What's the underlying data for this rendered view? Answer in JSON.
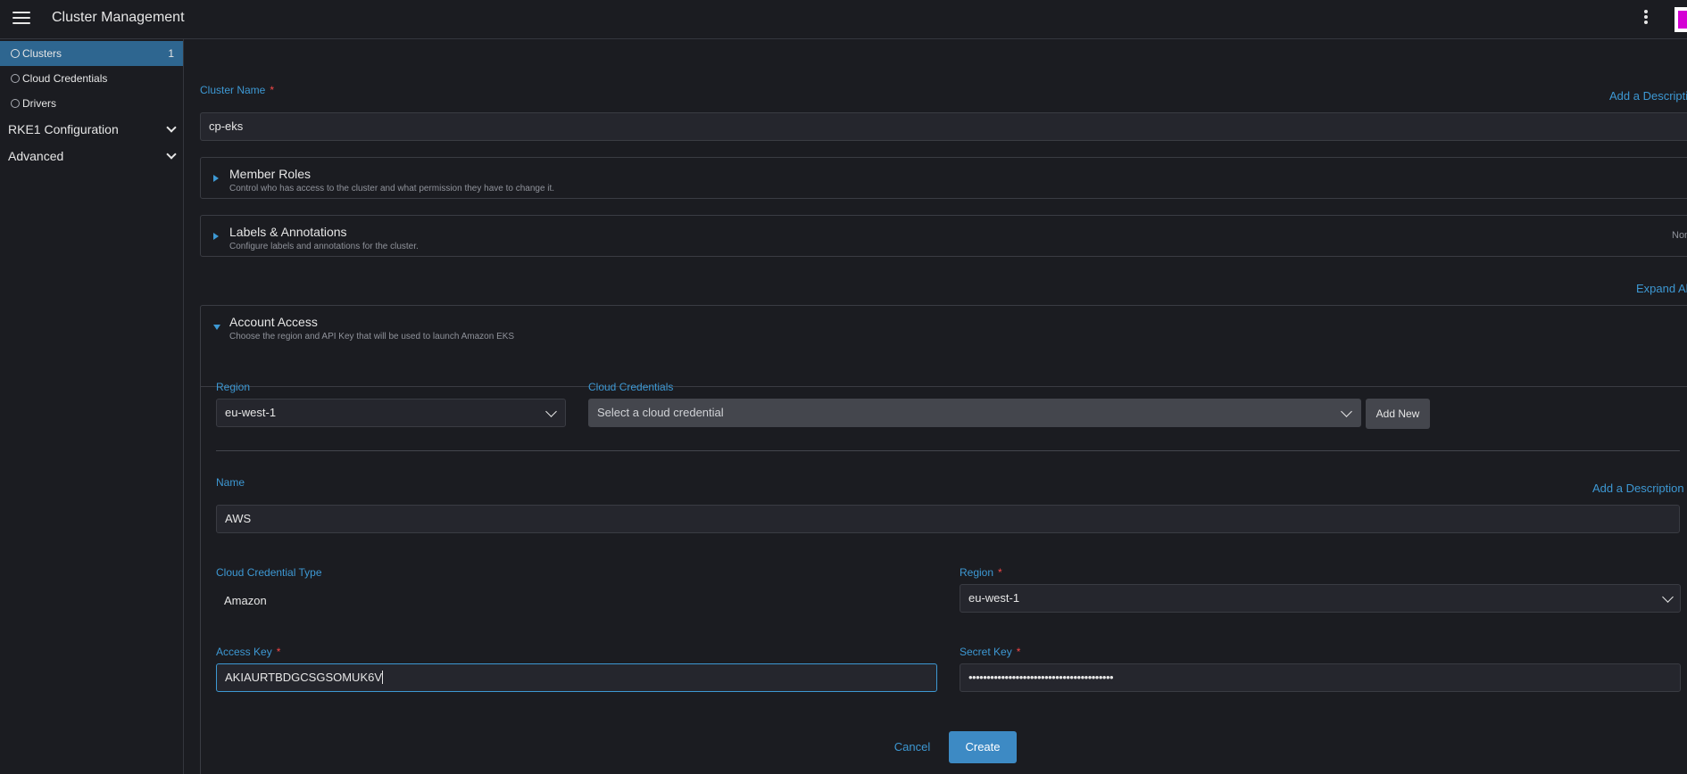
{
  "header": {
    "title": "Cluster Management"
  },
  "sidebar": {
    "items": [
      {
        "label": "Clusters",
        "count": "1"
      },
      {
        "label": "Cloud Credentials"
      },
      {
        "label": "Drivers"
      }
    ],
    "groups": [
      {
        "label": "RKE1 Configuration"
      },
      {
        "label": "Advanced"
      }
    ]
  },
  "form": {
    "cluster_name_label": "Cluster Name",
    "required_mark": "*",
    "add_description": "Add a Descripti",
    "cluster_name_value": "cp-eks",
    "expand_all": "Expand All"
  },
  "panels": {
    "member_roles": {
      "title": "Member Roles",
      "subtitle": "Control who has access to the cluster and what permission they have to change it."
    },
    "labels": {
      "title": "Labels & Annotations",
      "subtitle": "Configure labels and annotations for the cluster.",
      "badge": "None"
    },
    "account_access": {
      "title": "Account Access",
      "subtitle": "Choose the region and API Key that will be used to launch Amazon EKS"
    }
  },
  "account": {
    "region_label": "Region",
    "region_value": "eu-west-1",
    "cloud_credentials_label": "Cloud Credentials",
    "cloud_credentials_placeholder": "Select a cloud credential",
    "add_new": "Add New"
  },
  "credential": {
    "name_label": "Name",
    "add_description": "Add a Description",
    "name_value": "AWS",
    "type_label": "Cloud Credential Type",
    "type_value": "Amazon",
    "region_label": "Region",
    "region_value": "eu-west-1",
    "access_key_label": "Access Key",
    "access_key_value": "AKIAURTBDGCSGSOMUK6V",
    "secret_key_label": "Secret Key",
    "secret_key_value": "••••••••••••••••••••••••••••••••••••••••"
  },
  "actions": {
    "cancel": "Cancel",
    "create": "Create"
  }
}
